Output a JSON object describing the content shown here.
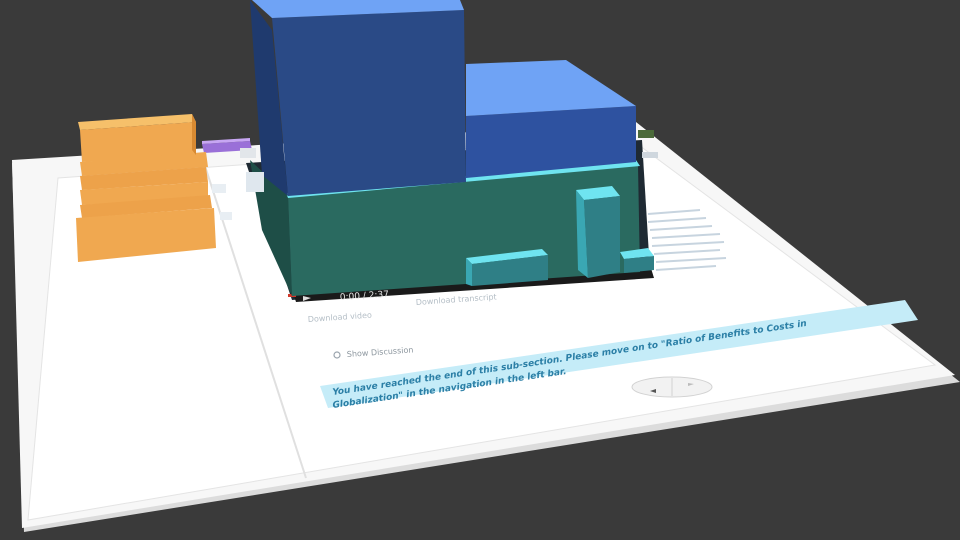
{
  "video": {
    "time": "0:00 / 2:37",
    "play_icon": "play-icon",
    "volume_icon": "volume-icon"
  },
  "links": {
    "download_video": "Download video",
    "download_transcript": "Download transcript"
  },
  "discussion": {
    "label": "Show Discussion",
    "icon": "speech-bubble-icon"
  },
  "notice": {
    "line1": "You have reached the end of this sub-section. Please move on to \"Ratio of Benefits to Costs in",
    "line2": "Globalization\" in the navigation in the left bar."
  },
  "pager": {
    "prev_icon": "chevron-left-icon",
    "next_icon": "chevron-right-icon"
  },
  "colors": {
    "background": "#3a3a3a",
    "page": "#f7f7f7",
    "notice_bg": "#c5ecf8",
    "notice_text": "#2b7fa6",
    "bar_blue_front": "#2a4a86",
    "bar_blue_top": "#6fa3f5",
    "bar_teal_front": "#2a6a60",
    "bar_cyan_top": "#6fe4f0",
    "bar_orange": "#f0a850",
    "bar_purple": "#9a70d8"
  }
}
